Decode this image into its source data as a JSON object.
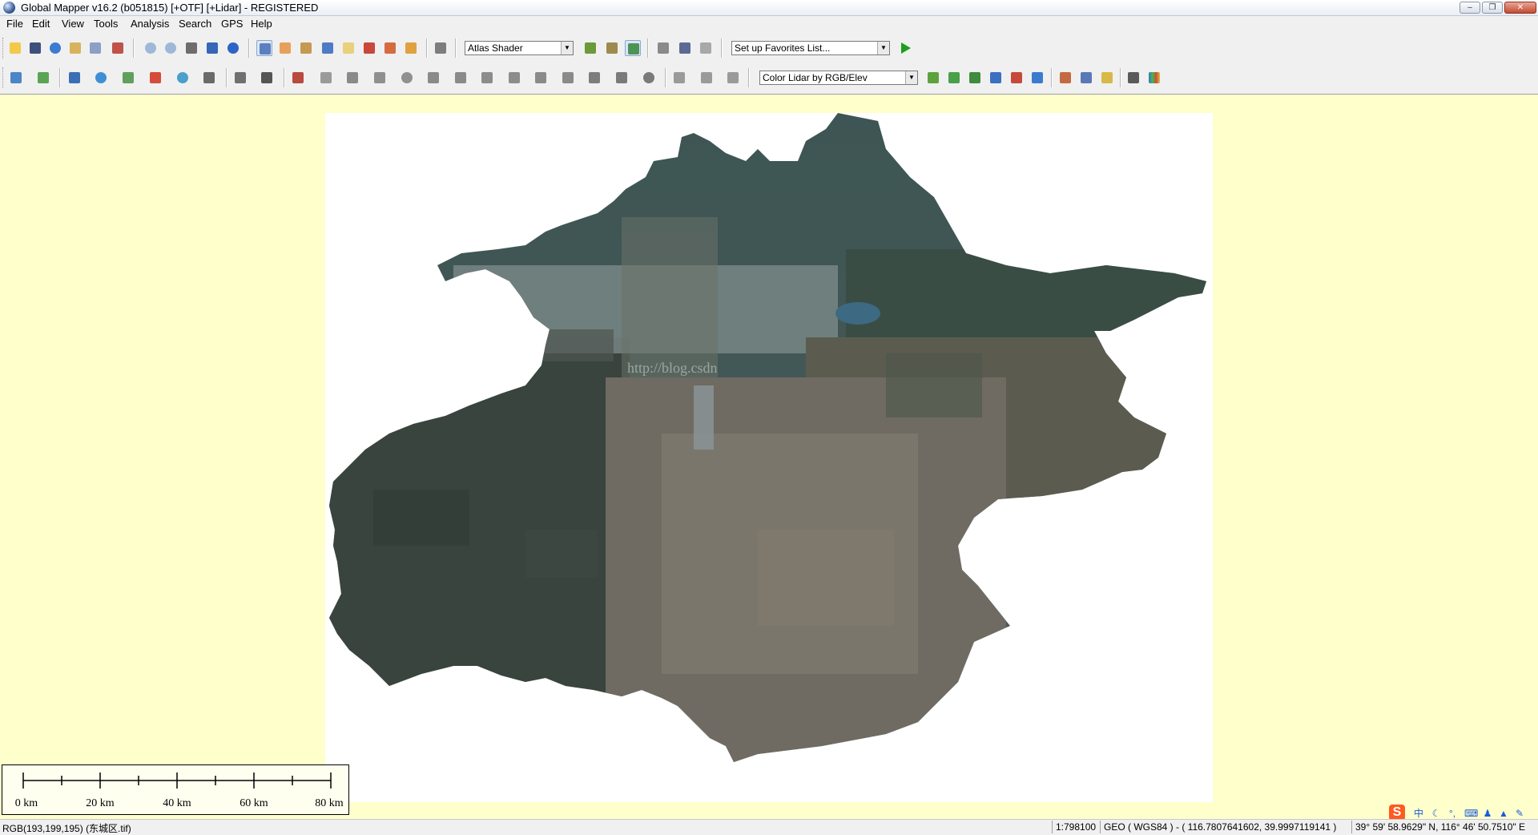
{
  "window": {
    "title": "Global Mapper v16.2 (b051815) [+OTF] [+Lidar] - REGISTERED",
    "controls": {
      "minimize": "‒",
      "maximize": "❐",
      "close": "✕"
    }
  },
  "menu": [
    "File",
    "Edit",
    "View",
    "Tools",
    "Analysis",
    "Search",
    "GPS",
    "Help"
  ],
  "toolbar": {
    "shader_select": "Atlas Shader",
    "favorites_select": "Set up Favorites List...",
    "lidar_color_select": "Color Lidar by RGB/Elev"
  },
  "map": {
    "watermark": "http://blog.csdn",
    "scale_labels": [
      "0 km",
      "20 km",
      "40 km",
      "60 km",
      "80 km"
    ]
  },
  "status": {
    "pixel_info": "RGB(193,199,195) (东城区.tif)",
    "scale": "1:798100",
    "projection": "GEO ( WGS84 ) - ( 116.7807641602, 39.9997119141 )",
    "dms": "39° 59' 58.9629\" N, 116° 46' 50.7510\" E"
  },
  "ime": {
    "logo": "S",
    "lang": "中"
  },
  "colors": {
    "map_background": "#ffffcc",
    "canvas": "#ffffff",
    "terrain_dark": "#3c4a45",
    "terrain_urban": "#6e6a60"
  }
}
